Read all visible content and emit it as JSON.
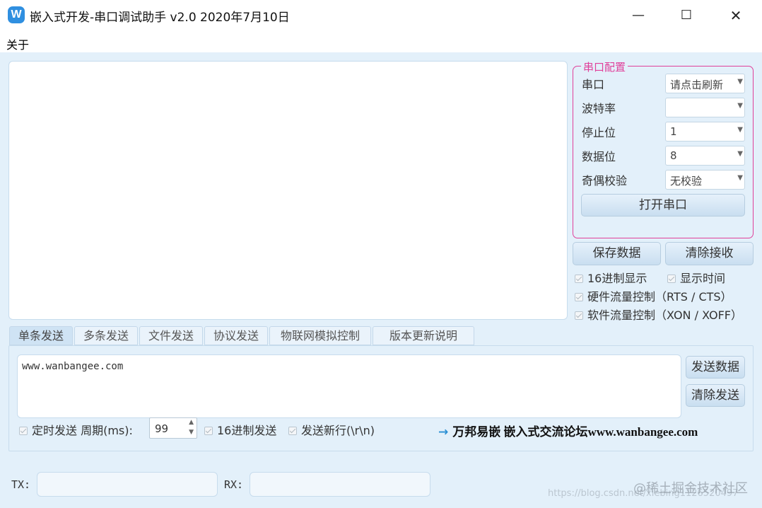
{
  "window": {
    "title": "嵌入式开发-串口调试助手 v2.0 2020年7月10日",
    "icon_letter": "W",
    "minimize": "—",
    "maximize": "☐",
    "close": "✕"
  },
  "menu": {
    "items": [
      {
        "label": "关于"
      }
    ]
  },
  "serial_config": {
    "legend": "串口配置",
    "fields": [
      {
        "label": "串口",
        "value": "请点击刷新"
      },
      {
        "label": "波特率",
        "value": ""
      },
      {
        "label": "停止位",
        "value": "1"
      },
      {
        "label": "数据位",
        "value": "8"
      },
      {
        "label": "奇偶校验",
        "value": "无校验"
      }
    ],
    "open_button": "打开串口"
  },
  "receive": {
    "save_button": "保存数据",
    "clear_button": "清除接收",
    "options": [
      {
        "label": "16进制显示",
        "checked": false
      },
      {
        "label": "显示时间",
        "checked": false
      },
      {
        "label": "硬件流量控制（RTS / CTS）",
        "checked": false
      },
      {
        "label": "软件流量控制（XON / XOFF）",
        "checked": false
      }
    ]
  },
  "tabs": [
    {
      "label": "单条发送",
      "active": true
    },
    {
      "label": "多条发送",
      "active": false
    },
    {
      "label": "文件发送",
      "active": false
    },
    {
      "label": "协议发送",
      "active": false
    },
    {
      "label": "物联网模拟控制",
      "active": false
    },
    {
      "label": "版本更新说明",
      "active": false
    }
  ],
  "send": {
    "text": "www.wanbangee.com",
    "send_button": "发送数据",
    "clear_button": "清除发送",
    "timer_label": "定时发送 周期(ms):",
    "period": "99",
    "hex_send_label": "16进制发送",
    "newline_label": "发送新行(\\r\\n)",
    "promo_arrow": "→",
    "promo_text": "万邦易嵌  嵌入式交流论坛www.wanbangee.com"
  },
  "status": {
    "tx_label": "TX:",
    "rx_label": "RX:",
    "tx_value": "",
    "rx_value": ""
  },
  "watermark": {
    "line1": "@稀土掘金技术社区",
    "line2": "https://blog.csdn.net/xiebing1126520497"
  },
  "colors": {
    "accent_pink": "#e0409a",
    "panel_bg": "#e3f0fa",
    "icon_blue": "#2f8fe0"
  }
}
